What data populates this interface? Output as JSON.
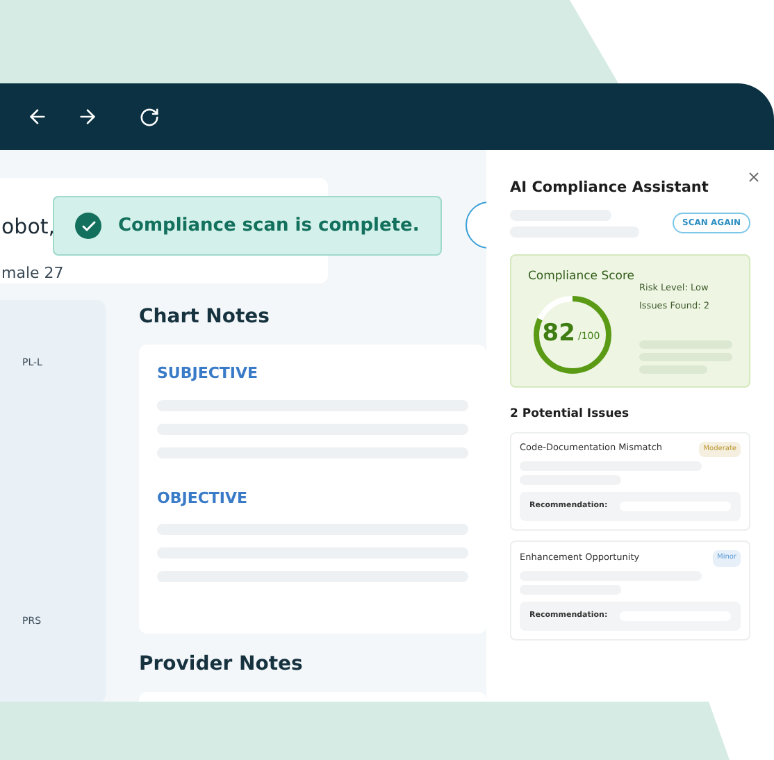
{
  "patient": {
    "name": "obot,",
    "details": "male 27"
  },
  "toast": {
    "message": "Compliance scan is complete."
  },
  "sidebar": {
    "labels": [
      "PL-L",
      "PRS"
    ]
  },
  "chart_notes": {
    "title": "Chart Notes",
    "sections": [
      "SUBJECTIVE",
      "OBJECTIVE"
    ]
  },
  "provider_notes": {
    "title": "Provider Notes"
  },
  "assistant": {
    "title": "AI Compliance Assistant",
    "scan_button": "SCAN AGAIN",
    "score": {
      "title": "Compliance Score",
      "value": "82",
      "max": "/100",
      "level": 0.82,
      "risk_label": "Risk Level:",
      "risk_value": "Low",
      "issues_label": "Issues Found:",
      "issues_value": "2"
    },
    "issues_heading": "2 Potential Issues",
    "issues": [
      {
        "title": "Code-Documentation Mismatch",
        "badge": "Moderate",
        "color": "#b9962f",
        "recommendation": "Recommendation:"
      },
      {
        "title": "Enhancement Opportunity",
        "badge": "Minor",
        "color": "#5b9bd5",
        "recommendation": "Recommendation:"
      }
    ]
  }
}
